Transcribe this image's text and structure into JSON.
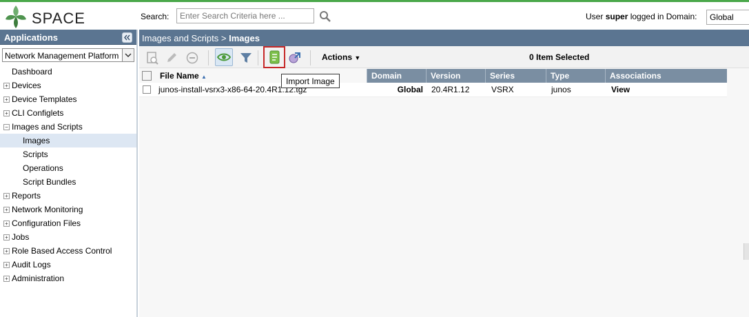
{
  "header": {
    "logo_text": "SPACE",
    "search_label": "Search:",
    "search_placeholder": "Enter Search Criteria here ...",
    "user_prefix": "User",
    "user_name": "super",
    "user_suffix": "logged in Domain:",
    "domain_value": "Global"
  },
  "sidebar": {
    "title": "Applications",
    "app_selected": "Network Management Platform",
    "items": [
      {
        "label": "Dashboard",
        "expander": "",
        "level": 0
      },
      {
        "label": "Devices",
        "expander": "+",
        "level": 0
      },
      {
        "label": "Device Templates",
        "expander": "+",
        "level": 0
      },
      {
        "label": "CLI Configlets",
        "expander": "+",
        "level": 0
      },
      {
        "label": "Images and Scripts",
        "expander": "−",
        "level": 0
      },
      {
        "label": "Images",
        "expander": "",
        "level": 1
      },
      {
        "label": "Scripts",
        "expander": "",
        "level": 1
      },
      {
        "label": "Operations",
        "expander": "",
        "level": 1
      },
      {
        "label": "Script Bundles",
        "expander": "",
        "level": 1
      },
      {
        "label": "Reports",
        "expander": "+",
        "level": 0
      },
      {
        "label": "Network Monitoring",
        "expander": "+",
        "level": 0
      },
      {
        "label": "Configuration Files",
        "expander": "+",
        "level": 0
      },
      {
        "label": "Jobs",
        "expander": "+",
        "level": 0
      },
      {
        "label": "Role Based Access Control",
        "expander": "+",
        "level": 0
      },
      {
        "label": "Audit Logs",
        "expander": "+",
        "level": 0
      },
      {
        "label": "Administration",
        "expander": "+",
        "level": 0
      }
    ]
  },
  "breadcrumb": {
    "parent": "Images and Scripts",
    "separator": ">",
    "current": "Images"
  },
  "toolbar": {
    "actions_label": "Actions",
    "selected_text": "0 Item Selected",
    "tooltip": "Import Image"
  },
  "grid": {
    "columns": [
      "File Name",
      "Domain",
      "Version",
      "Series",
      "Type",
      "Associations"
    ],
    "sort_indicator": "▲",
    "rows": [
      {
        "file_name": "junos-install-vsrx3-x86-64-20.4R1.12.tgz",
        "domain": "Global",
        "version": "20.4R1.12",
        "series": "VSRX",
        "type": "junos",
        "associations": "View"
      }
    ]
  },
  "colors": {
    "accent_bar": "#4aa84a",
    "header_blue": "#5b7591",
    "grid_header": "#7a8ea2",
    "highlight_red": "#c62828"
  }
}
